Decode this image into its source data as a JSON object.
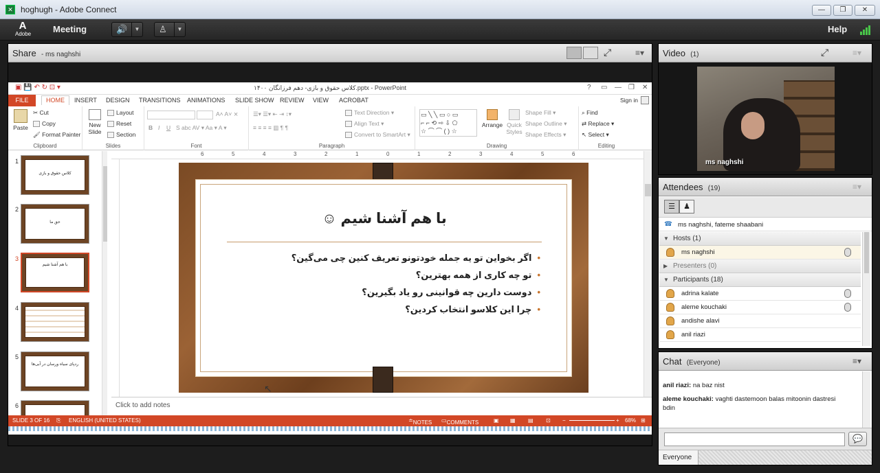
{
  "window": {
    "title": "hoghugh - Adobe Connect",
    "min": "—",
    "restore": "❐",
    "close": "✕"
  },
  "menubar": {
    "logo_text": "Adobe",
    "meeting_label": "Meeting",
    "help_label": "Help"
  },
  "share": {
    "title": "Share",
    "subtitle": "- ms naghshi",
    "ppt": {
      "doc_title": "کلاس حقوق و بازی- دهم فرزانگان ۱۴۰۰.pptx - PowerPoint",
      "sign_in": "Sign in",
      "tabs": [
        "FILE",
        "HOME",
        "INSERT",
        "DESIGN",
        "TRANSITIONS",
        "ANIMATIONS",
        "SLIDE SHOW",
        "REVIEW",
        "VIEW",
        "ACROBAT"
      ],
      "ribbon": {
        "clipboard": {
          "paste": "Paste",
          "cut": "Cut",
          "copy": "Copy",
          "format_painter": "Format Painter",
          "label": "Clipboard"
        },
        "slides": {
          "new_slide": "New Slide",
          "layout": "Layout",
          "reset": "Reset",
          "section": "Section",
          "label": "Slides"
        },
        "font": {
          "label": "Font"
        },
        "paragraph": {
          "text_direction": "Text Direction",
          "align_text": "Align Text",
          "convert": "Convert to SmartArt",
          "label": "Paragraph"
        },
        "drawing": {
          "arrange": "Arrange",
          "quick_styles": "Quick Styles",
          "shape_fill": "Shape Fill",
          "shape_outline": "Shape Outline",
          "shape_effects": "Shape Effects",
          "label": "Drawing"
        },
        "editing": {
          "find": "Find",
          "replace": "Replace",
          "select": "Select",
          "label": "Editing"
        }
      },
      "thumbnails": [
        {
          "num": "1",
          "text": "کلاس حقوق و بازی"
        },
        {
          "num": "2",
          "text": "حق ما"
        },
        {
          "num": "3",
          "text": "با هم آشنا شیم"
        },
        {
          "num": "4",
          "text": ""
        },
        {
          "num": "5",
          "text": "ردپای سیاه ورسان در آبی‌ها"
        },
        {
          "num": "6",
          "text": ""
        }
      ],
      "ruler": [
        "6",
        "5",
        "4",
        "3",
        "2",
        "1",
        "0",
        "1",
        "2",
        "3",
        "4",
        "5",
        "6"
      ],
      "slide": {
        "title": "با هم آشنا شیم ☺",
        "bullets": [
          "اگر بخواین تو یه جمله خودتونو تعریف کنین چی می‌گین؟",
          "تو چه کاری از همه بهترین؟",
          "دوست دارین چه قوانینی رو یاد بگیرین؟",
          "چرا این کلاسو انتخاب کردین؟"
        ]
      },
      "notes_placeholder": "Click to add notes",
      "status": {
        "slide": "SLIDE 3 OF 16",
        "language": "ENGLISH (UNITED STATES)",
        "notes": "NOTES",
        "comments": "COMMENTS",
        "zoom": "68%"
      }
    }
  },
  "video": {
    "title": "Video",
    "count": "(1)",
    "speaker": "ms naghshi"
  },
  "attendees": {
    "title": "Attendees",
    "count": "(19)",
    "speaking": "ms naghshi, fateme shaabani",
    "hosts_header": "Hosts (1)",
    "hosts": [
      {
        "name": "ms naghshi"
      }
    ],
    "presenters_header": "Presenters (0)",
    "participants_header": "Participants (18)",
    "participants": [
      {
        "name": "adrina kalate"
      },
      {
        "name": "aleme kouchaki"
      },
      {
        "name": "andishe alavi"
      },
      {
        "name": "anil riazi"
      }
    ]
  },
  "chat": {
    "title": "Chat",
    "scope": "(Everyone)",
    "messages": [
      {
        "sender": "anil riazi:",
        "text": "na baz nist"
      },
      {
        "sender": "aleme kouchaki:",
        "text": "vaghti dastemoon balas mitoonin dastresi bdin"
      }
    ],
    "input_placeholder": "",
    "recipient": "Everyone"
  },
  "colors": {
    "ppt_accent": "#d24726",
    "adobe_green": "#3fd63f"
  }
}
